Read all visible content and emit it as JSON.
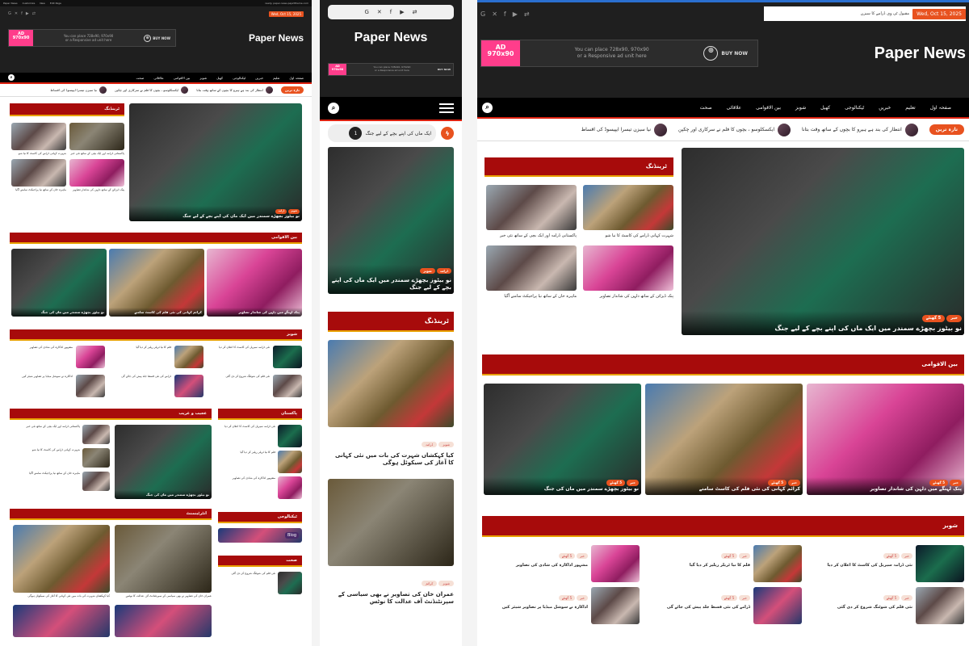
{
  "site": {
    "logo": "Paper News",
    "date_badge": "Wed, Oct 15, 2025",
    "topbar_url": "ready. paper-news.peja3theme.com"
  },
  "topbar": {
    "links": [
      "Paper News",
      "Customize",
      "0",
      "New",
      "Edit Page"
    ]
  },
  "ad": {
    "tag": "AD",
    "size": "970x90",
    "line1": "You can place 728x90, 970x90",
    "line2": "or a Responsive ad unit here",
    "buy": "BUY NOW"
  },
  "nav": [
    "صفحہ اول",
    "تعلیم",
    "خبریں",
    "ٹیکنالوجی",
    "کھیل",
    "شوبز",
    "بین الاقوامی",
    "علاقائی",
    "صحت"
  ],
  "ticker": {
    "badge": "تازہ ترین",
    "items": [
      "انتظار کی بند ہے ہیرو کا بچوں کے ساتھ وقت بتانا",
      "ایکسکلوسو ، بچوں کا فلم نے سرکاری اور چکپن",
      "نیا سیزن تیسرا ایپیسوڈ کی اقساط",
      "مقبول ٹی وی ڈرامے کا سیزن"
    ],
    "mobile_item": "ایک ماں کی اپنے بچے کے لیے جنگ"
  },
  "sections": {
    "trending": "ٹرینڈنگ",
    "international": "بین الاقوامی",
    "showbiz": "شوبز",
    "pakistan": "پاکستان",
    "ajab": "عجیب و غریب",
    "entertainment": "انٹرٹینمنٹ",
    "tech": "ٹیکنالوجی",
    "health": "صحت"
  },
  "hero": {
    "category_a": "شوبز",
    "category_b": "ڈرامہ",
    "title": "نو بیٹوز بچھڑے سمندر میں ایک ماں کی اپنے بچے کے لیے جنگ"
  },
  "trending_small": [
    "پاکستانی ڈرامہ اور ایک بچی کے ساتھ نئی خبر",
    "شہرت کہانی ڈرامے کی کاسٹ کا نیا شو",
    "ماہرہ خان کے ساتھ نیا پراجیکٹ سامنے آگیا",
    "پنک ڈیزائن کے ساتھ دلہن کی شاندار تصاویر"
  ],
  "intl_cards": [
    "نو بیٹوز بچھڑے سمندر میں ماں کی جنگ",
    "کرائم کہانی کی نئی فلم کی کاسٹ سامنے",
    "پنک لہنگے میں دلہن کی شاندار تصاویر"
  ],
  "mobile_cards": [
    {
      "tag1": "شوبز",
      "tag2": "ڈرامہ",
      "title": "کیا کہکشاں شہرت کی بات میں نئی کہانی کا آغاز کی سیکوئل ہوگی"
    },
    {
      "tag1": "شوبز",
      "tag2": "کرائم",
      "title": "عمران خان کی تصاویر نے بھی سیاسی کے سپرنٹنڈنٹ آف عدالت کا نوٹس"
    }
  ],
  "showbiz_list": [
    "نئی ڈرامہ سیریل کی کاسٹ کا اعلان کر دیا",
    "فلم کا نیا ٹریلر ریلیز کر دیا گیا",
    "مشہور اداکارہ کی شادی کی تصاویر",
    "نئی فلم کی شوٹنگ شروع کر دی گئی",
    "ڈرامے کی نئی قسط جلد پیش کی جائے گی",
    "اداکارہ نے سوشل میڈیا پر تصاویر شیئر کیں"
  ],
  "badges": {
    "a": "5 گھنٹے",
    "b": "خبر"
  },
  "blog_tag": "Blog"
}
